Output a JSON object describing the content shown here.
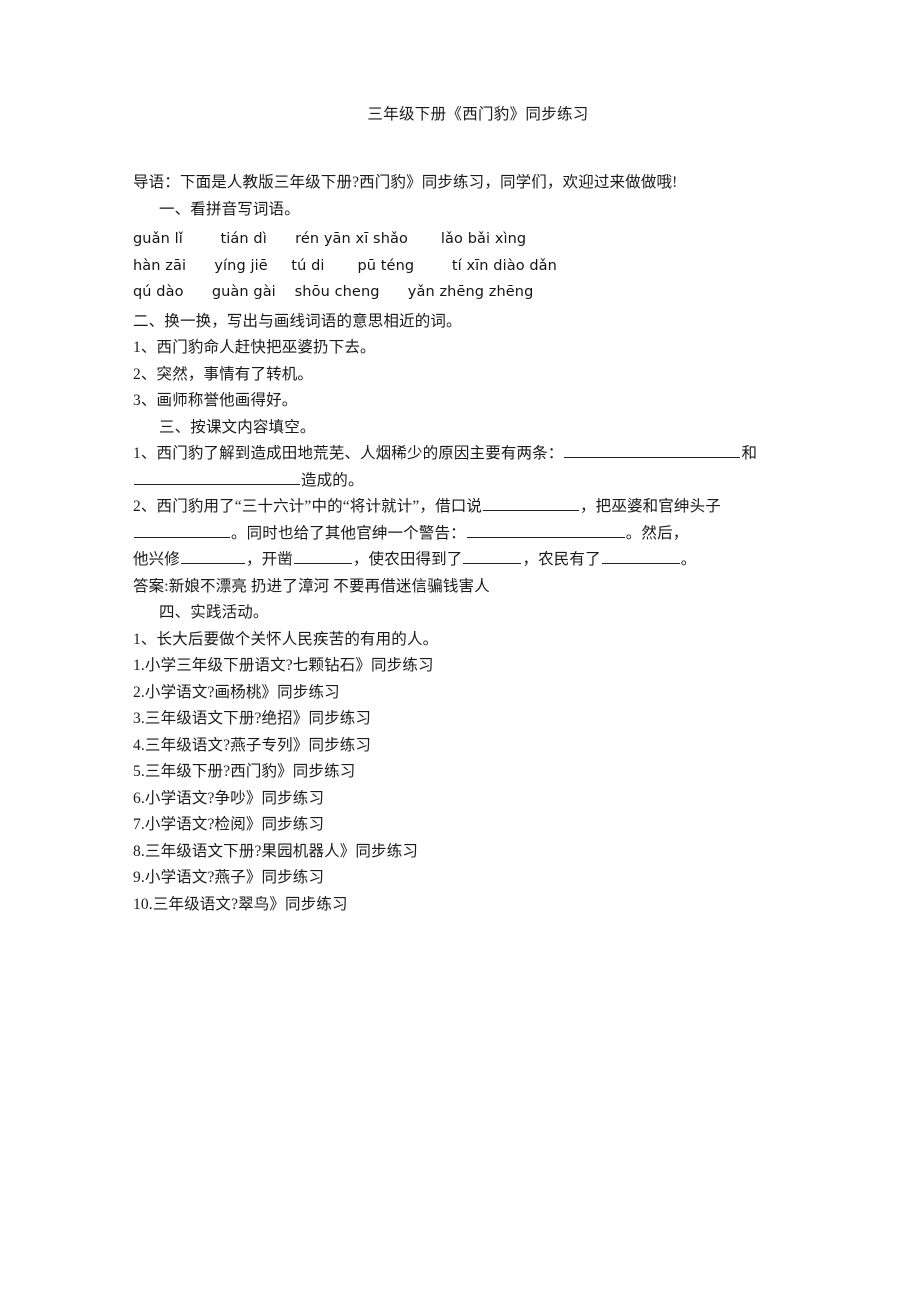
{
  "document": {
    "title": "三年级下册《西门豹》同步练习",
    "intro": "导语：下面是人教版三年级下册?西门豹》同步练习，同学们，欢迎过来做做哦!",
    "section_one_heading": "一、看拼音写词语。",
    "pinyin_rows": [
      "guǎn lǐ        tián dì      rén yān xī shǎo       lǎo bǎi xìng",
      "hàn zāi      yíng jiē     tú di       pū téng        tí xīn diào dǎn",
      "qú dào      guàn gài    shōu cheng      yǎn zhēng zhēng"
    ],
    "section_two_heading": "二、换一换，写出与画线词语的意思相近的词。",
    "section_two_items": [
      "1、西门豹命人赶快把巫婆扔下去。",
      "2、突然，事情有了转机。",
      "3、画师称誉他画得好。"
    ],
    "section_three_heading": "三、按课文内容填空。",
    "q1_part1": "1、西门豹了解到造成田地荒芜、人烟稀少的原因主要有两条：",
    "q1_part2": "和",
    "q1_part3": "造成的。",
    "q2_part1": "2、西门豹用了“三十六计”中的“将计就计”，借口说",
    "q2_part2": "，把巫婆和官绅头子",
    "q2_part3": "。同时也给了其他官绅一个警告：",
    "q2_part4": "。然后，",
    "q3_part1": "他兴修",
    "q3_part2": "，开凿",
    "q3_part3": "，使农田得到了",
    "q3_part4": "，农民有了",
    "q3_part5": "。",
    "answer_line": "答案:新娘不漂亮 扔进了漳河 不要再借迷信骗钱害人",
    "section_four_heading": "四、实践活动。",
    "section_four_item": "1、长大后要做个关怀人民疾苦的有用的人。",
    "related_list": [
      "1.小学三年级下册语文?七颗钻石》同步练习",
      "2.小学语文?画杨桃》同步练习",
      "3.三年级语文下册?绝招》同步练习",
      "4.三年级语文?燕子专列》同步练习",
      "5.三年级下册?西门豹》同步练习",
      "6.小学语文?争吵》同步练习",
      "7.小学语文?检阅》同步练习",
      "8.三年级语文下册?果园机器人》同步练习",
      "9.小学语文?燕子》同步练习",
      "10.三年级语文?翠鸟》同步练习"
    ]
  }
}
